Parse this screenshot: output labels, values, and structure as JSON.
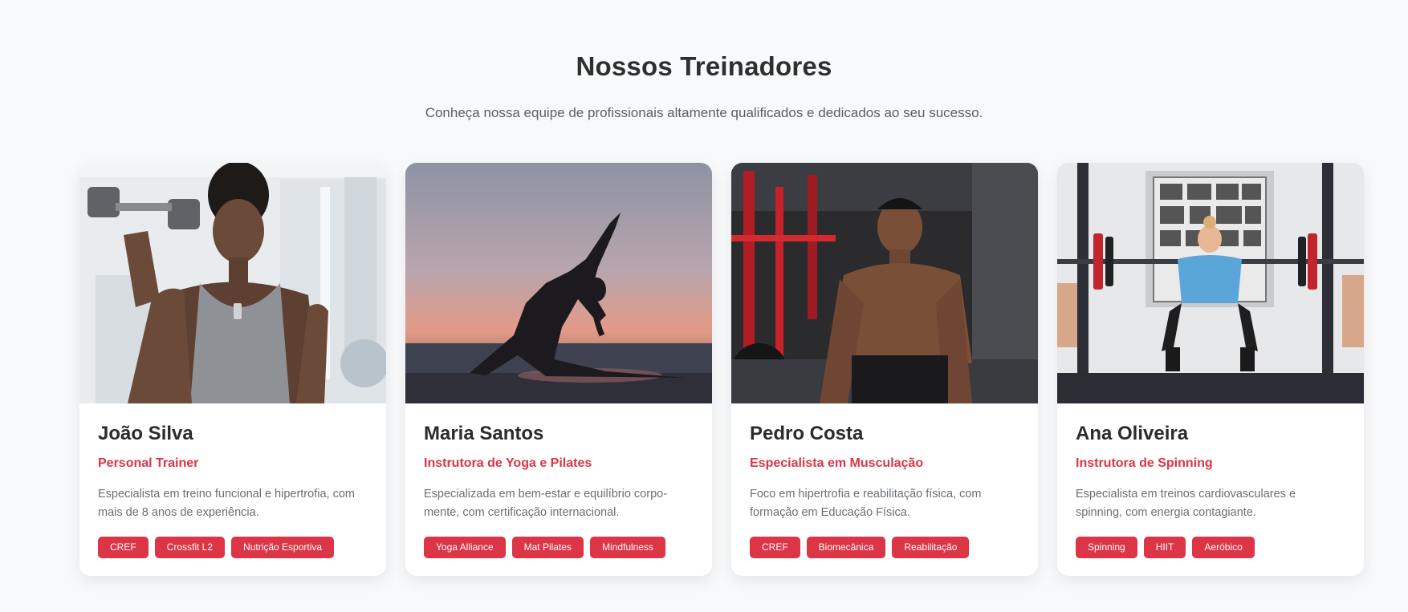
{
  "header": {
    "title": "Nossos Treinadores",
    "subtitle": "Conheça nossa equipe de profissionais altamente qualificados e dedicados ao seu sucesso."
  },
  "accent_color": "#dc3545",
  "trainers": [
    {
      "name": "João Silva",
      "role": "Personal Trainer",
      "description": "Especialista em treino funcional e hipertrofia, com mais de 8 anos de experiência.",
      "tags": [
        "CREF",
        "Crossfit L2",
        "Nutrição Esportiva"
      ],
      "photo": "gym-man-dumbbell-photo"
    },
    {
      "name": "Maria Santos",
      "role": "Instrutora de Yoga e Pilates",
      "description": "Especializada em bem-estar e equilíbrio corpo-mente, com certificação internacional.",
      "tags": [
        "Yoga Alliance",
        "Mat Pilates",
        "Mindfulness"
      ],
      "photo": "yoga-silhouette-sunset-photo"
    },
    {
      "name": "Pedro Costa",
      "role": "Especialista em Musculação",
      "description": "Foco em hipertrofia e reabilitação física, com formação em Educação Física.",
      "tags": [
        "CREF",
        "Biomecânica",
        "Reabilitação"
      ],
      "photo": "gym-man-training-photo"
    },
    {
      "name": "Ana Oliveira",
      "role": "Instrutora de Spinning",
      "description": "Especialista em treinos cardiovasculares e spinning, com energia contagiante.",
      "tags": [
        "Spinning",
        "HIIT",
        "Aeróbico"
      ],
      "photo": "woman-squat-rack-photo"
    }
  ]
}
